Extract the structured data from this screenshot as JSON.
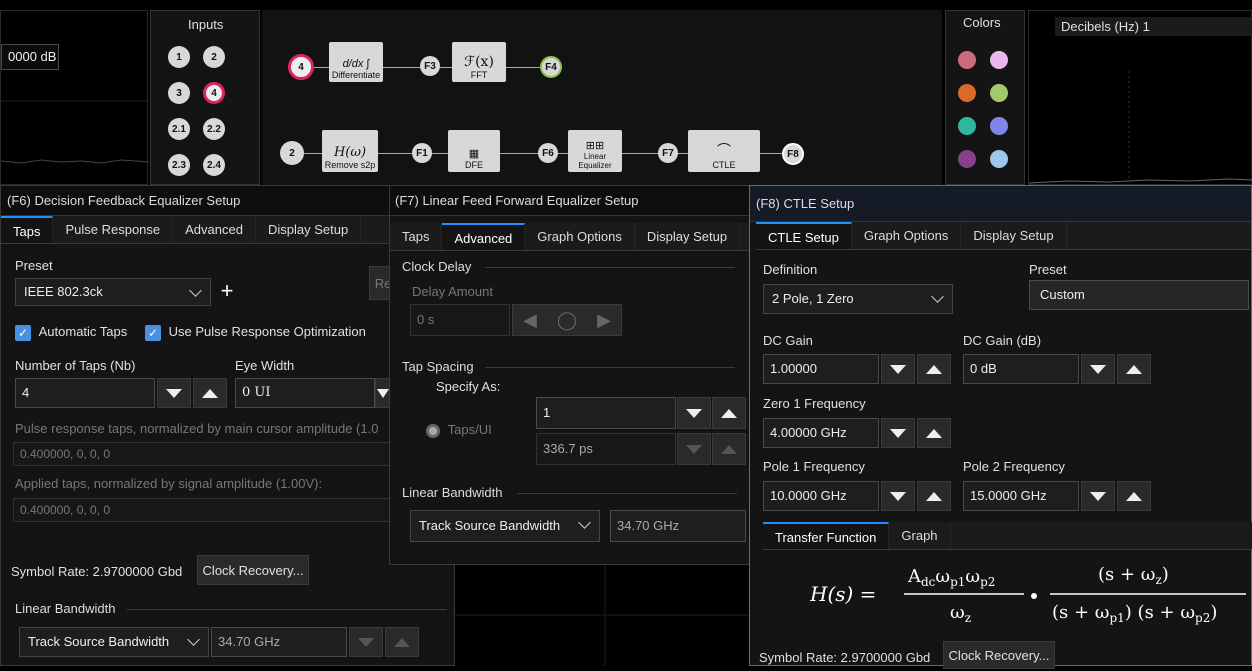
{
  "top": {
    "left_readout": "0000 dB",
    "inputs_title": "Inputs",
    "inputs": [
      "1",
      "2",
      "3",
      "4",
      "2.1",
      "2.2",
      "2.3",
      "2.4"
    ],
    "colors_title": "Colors",
    "swatches": [
      "#c96b7a",
      "#eab8ee",
      "#d96a2a",
      "#a6c86c",
      "#2fb8a0",
      "#7f86e8",
      "#8a3f8c",
      "#9cc8ee"
    ],
    "right_title": "Decibels (Hz) 1",
    "flow1": {
      "src": "4",
      "n1": "Differentiate",
      "f1": "F3",
      "n2": "FFT",
      "n2_sym": "ℱ(x)",
      "f2": "F4"
    },
    "flow2": {
      "src": "2",
      "n1": "Remove s2p",
      "n1_sym": "H(ω)",
      "f1": "F1",
      "n2": "DFE",
      "f2": "F6",
      "n3": "Linear Equalizer",
      "f3": "F7",
      "n4": "CTLE",
      "f4": "F8"
    }
  },
  "dfe": {
    "title": "(F6) Decision Feedback Equalizer Setup",
    "tabs": [
      "Taps",
      "Pulse Response",
      "Advanced",
      "Display Setup"
    ],
    "preset_label": "Preset",
    "preset_value": "IEEE 802.3ck",
    "plus": "+",
    "cut_button": "Re",
    "auto_taps": "Automatic Taps",
    "use_pulse": "Use Pulse Response Optimization",
    "num_taps_label": "Number of Taps (Nb)",
    "num_taps_value": "4",
    "eye_width_label": "Eye Width",
    "eye_width_value": "0 UI",
    "pulse_taps_label": "Pulse response taps, normalized by main cursor amplitude (1.0",
    "pulse_taps_value": "0.400000, 0, 0, 0",
    "applied_taps_label": "Applied taps, normalized by signal amplitude (1.00V):",
    "applied_taps_value": "0.400000, 0, 0, 0",
    "symbol_rate": "Symbol Rate: 2.9700000 Gbd",
    "clock_recovery": "Clock Recovery...",
    "linear_bw_label": "Linear Bandwidth",
    "linear_bw_select": "Track Source Bandwidth",
    "linear_bw_value": "34.70 GHz"
  },
  "ffe": {
    "title": "(F7) Linear Feed Forward Equalizer Setup",
    "tabs": [
      "Taps",
      "Advanced",
      "Graph Options",
      "Display Setup"
    ],
    "clock_delay": "Clock Delay",
    "delay_amount": "Delay Amount",
    "delay_value": "0 s",
    "tap_spacing": "Tap Spacing",
    "specify_as": "Specify As:",
    "taps_ui": "Taps/UI",
    "taps_ui_value": "1",
    "ps_value": "336.7 ps",
    "linear_bw_label": "Linear Bandwidth",
    "linear_bw_select": "Track Source Bandwidth",
    "linear_bw_value": "34.70 GHz"
  },
  "ctle": {
    "title": "(F8) CTLE Setup",
    "tabs": [
      "CTLE Setup",
      "Graph Options",
      "Display Setup"
    ],
    "definition_label": "Definition",
    "definition_value": "2 Pole, 1 Zero",
    "preset_label": "Preset",
    "preset_value": "Custom",
    "dc_gain_label": "DC Gain",
    "dc_gain_value": "1.00000",
    "dc_gain_db_label": "DC Gain (dB)",
    "dc_gain_db_value": "0 dB",
    "zero1_label": "Zero 1 Frequency",
    "zero1_value": "4.00000 GHz",
    "pole1_label": "Pole 1 Frequency",
    "pole1_value": "10.0000 GHz",
    "pole2_label": "Pole 2 Frequency",
    "pole2_value": "15.0000 GHz",
    "sub_tabs": [
      "Transfer Function",
      "Graph"
    ],
    "symbol_rate": "Symbol Rate: 2.9700000 Gbd",
    "clock_recovery": "Clock Recovery..."
  }
}
